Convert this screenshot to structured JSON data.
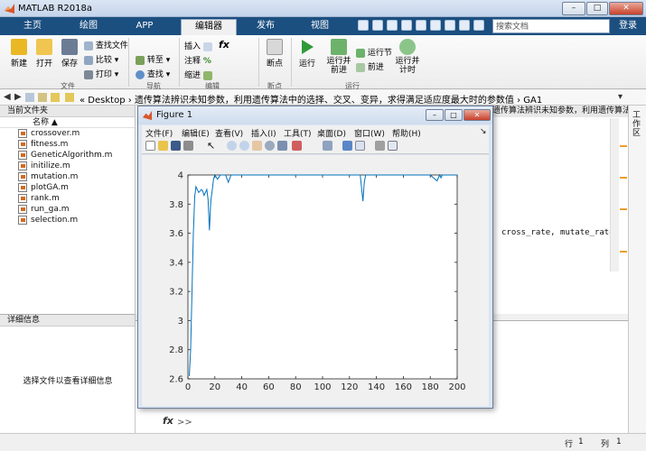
{
  "app": {
    "title": "MATLAB R2018a",
    "window_buttons": {
      "minimize": "–",
      "restore": "□",
      "close": "✕"
    }
  },
  "tabs": [
    {
      "label": "主页"
    },
    {
      "label": "绘图"
    },
    {
      "label": "APP"
    },
    {
      "label": "编辑器"
    },
    {
      "label": "发布"
    },
    {
      "label": "视图"
    }
  ],
  "search": {
    "placeholder": "搜索文档"
  },
  "login": "登录",
  "ribbon": {
    "new": "新建",
    "open": "打开",
    "save": "保存",
    "find_files": "查找文件",
    "compare": "比较",
    "print": "打印",
    "goto": "转至",
    "find": "查找",
    "insert": "插入",
    "comment": "注释",
    "indent": "缩进",
    "fx": "fx",
    "breakpoints": "断点",
    "run": "运行",
    "run_advance": "运行并前进",
    "run_section": "运行节",
    "advance": "前进",
    "run_time": "运行并计时",
    "groups": {
      "file": "文件",
      "navigate": "导航",
      "edit": "编辑",
      "breakpoints": "断点",
      "run": "运行"
    }
  },
  "address": {
    "path": "«  Desktop  ›  遗传算法辨识未知参数，利用遗传算法中的选择、交叉、变异，求得满足适应度最大时的参数值  ›  GA1"
  },
  "file_panel": {
    "title": "当前文件夹",
    "column": "名称 ▲",
    "files": [
      "crossover.m",
      "fitness.m",
      "GeneticAlgorithm.m",
      "initilize.m",
      "mutation.m",
      "plotGA.m",
      "rank.m",
      "run_ga.m",
      "selection.m"
    ]
  },
  "detail_panel": {
    "title": "详细信息",
    "message": "选择文件以查看详细信息"
  },
  "editor": {
    "tab_path": "遗传算法辨识未知参数，利用遗传算法中的选择、交叉、变异",
    "code": "cross_rate, mutate_rate,"
  },
  "command_window": {
    "prompt": "fx",
    "arrows": ">>"
  },
  "workspace_strip": {
    "title": "工作区"
  },
  "status": {
    "row_label": "行",
    "row": "1",
    "col_label": "列",
    "col": "1"
  },
  "figure": {
    "title": "Figure 1",
    "menu": [
      "文件(F)",
      "编辑(E)",
      "查看(V)",
      "插入(I)",
      "工具(T)",
      "桌面(D)",
      "窗口(W)",
      "帮助(H)"
    ]
  },
  "chart_data": {
    "type": "line",
    "title": "",
    "xlabel": "",
    "ylabel": "",
    "xlim": [
      0,
      200
    ],
    "ylim": [
      2.6,
      4
    ],
    "xticks": [
      0,
      20,
      40,
      60,
      80,
      100,
      120,
      140,
      160,
      180,
      200
    ],
    "yticks": [
      2.6,
      2.8,
      3,
      3.2,
      3.4,
      3.6,
      3.8,
      4
    ],
    "series": [
      {
        "color": "#0072bd",
        "x": [
          1,
          2,
          3,
          4,
          5,
          6,
          7,
          8,
          9,
          10,
          11,
          12,
          13,
          14,
          15,
          16,
          17,
          18,
          19,
          20,
          22,
          24,
          26,
          28,
          30,
          32,
          34,
          36,
          40,
          50,
          60,
          70,
          80,
          90,
          100,
          110,
          120,
          128,
          130,
          131,
          132,
          134,
          136,
          140,
          150,
          160,
          170,
          180,
          185,
          187,
          188,
          189,
          190,
          192,
          195,
          200
        ],
        "y": [
          2.62,
          2.8,
          3.2,
          3.6,
          3.85,
          3.92,
          3.9,
          3.88,
          3.89,
          3.9,
          3.89,
          3.86,
          3.88,
          3.9,
          3.83,
          3.62,
          3.82,
          3.89,
          3.97,
          4,
          3.97,
          4,
          4,
          4,
          3.95,
          4,
          4,
          4,
          4,
          4,
          4,
          4,
          4,
          4,
          4,
          4,
          4,
          4,
          3.82,
          3.95,
          4,
          4,
          4,
          4,
          4,
          4,
          4,
          4,
          3.96,
          4,
          3.98,
          4,
          4,
          4,
          4,
          4
        ]
      }
    ]
  }
}
